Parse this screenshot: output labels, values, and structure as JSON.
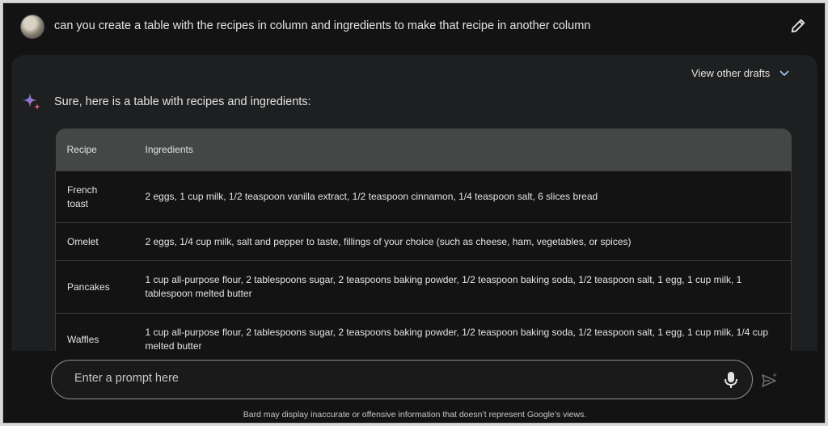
{
  "user_query": "can you create a table with the recipes in column and ingredients to make that recipe in another column",
  "response": {
    "view_drafts_label": "View other drafts",
    "intro_text": "Sure, here is a table with recipes and ingredients:",
    "table": {
      "headers": [
        "Recipe",
        "Ingredients"
      ],
      "rows": [
        {
          "recipe_line1": "French",
          "recipe_line2": "toast",
          "ingredients": "2 eggs, 1 cup milk, 1/2 teaspoon vanilla extract, 1/2 teaspoon cinnamon, 1/4 teaspoon salt, 6 slices bread"
        },
        {
          "recipe_line1": "Omelet",
          "recipe_line2": "",
          "ingredients": "2 eggs, 1/4 cup milk, salt and pepper to taste, fillings of your choice (such as cheese, ham, vegetables, or spices)"
        },
        {
          "recipe_line1": "Pancakes",
          "recipe_line2": "",
          "ingredients": "1 cup all-purpose flour, 2 tablespoons sugar, 2 teaspoons baking powder, 1/2 teaspoon baking soda, 1/2 teaspoon salt, 1 egg, 1 cup milk, 1 tablespoon melted butter"
        },
        {
          "recipe_line1": "Waffles",
          "recipe_line2": "",
          "ingredients": "1 cup all-purpose flour, 2 tablespoons sugar, 2 teaspoons baking powder, 1/2 teaspoon baking soda, 1/2 teaspoon salt, 1 egg, 1 cup milk, 1/4 cup melted butter"
        }
      ]
    }
  },
  "prompt": {
    "placeholder": "Enter a prompt here"
  },
  "disclaimer": "Bard may display inaccurate or offensive information that doesn’t represent Google’s views.",
  "icons": {
    "edit": "pencil-icon",
    "spark": "bard-sparkle-icon",
    "chevron": "chevron-down-icon",
    "mic": "microphone-icon",
    "send": "send-icon"
  },
  "colors": {
    "background": "#131314",
    "card": "#1e1f20",
    "table_header": "#444746",
    "text": "#e3e3e3"
  }
}
